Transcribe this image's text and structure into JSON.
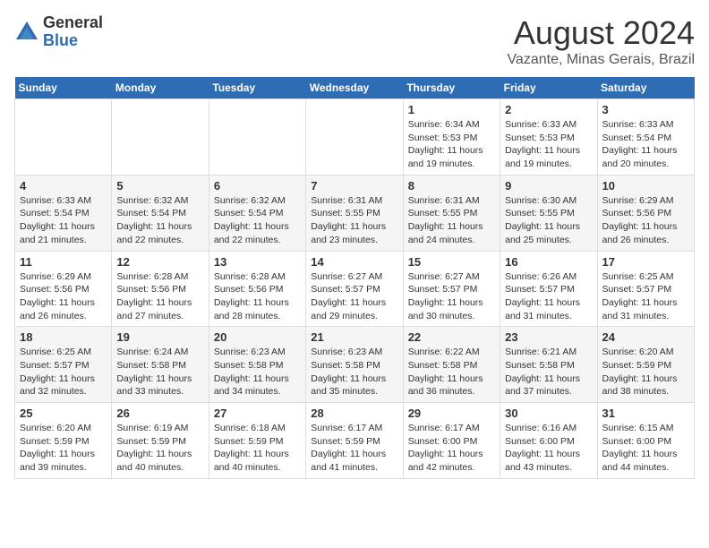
{
  "header": {
    "logo_general": "General",
    "logo_blue": "Blue",
    "month_title": "August 2024",
    "subtitle": "Vazante, Minas Gerais, Brazil"
  },
  "weekdays": [
    "Sunday",
    "Monday",
    "Tuesday",
    "Wednesday",
    "Thursday",
    "Friday",
    "Saturday"
  ],
  "weeks": [
    [
      {
        "day": "",
        "info": ""
      },
      {
        "day": "",
        "info": ""
      },
      {
        "day": "",
        "info": ""
      },
      {
        "day": "",
        "info": ""
      },
      {
        "day": "1",
        "info": "Sunrise: 6:34 AM\nSunset: 5:53 PM\nDaylight: 11 hours and 19 minutes."
      },
      {
        "day": "2",
        "info": "Sunrise: 6:33 AM\nSunset: 5:53 PM\nDaylight: 11 hours and 19 minutes."
      },
      {
        "day": "3",
        "info": "Sunrise: 6:33 AM\nSunset: 5:54 PM\nDaylight: 11 hours and 20 minutes."
      }
    ],
    [
      {
        "day": "4",
        "info": "Sunrise: 6:33 AM\nSunset: 5:54 PM\nDaylight: 11 hours and 21 minutes."
      },
      {
        "day": "5",
        "info": "Sunrise: 6:32 AM\nSunset: 5:54 PM\nDaylight: 11 hours and 22 minutes."
      },
      {
        "day": "6",
        "info": "Sunrise: 6:32 AM\nSunset: 5:54 PM\nDaylight: 11 hours and 22 minutes."
      },
      {
        "day": "7",
        "info": "Sunrise: 6:31 AM\nSunset: 5:55 PM\nDaylight: 11 hours and 23 minutes."
      },
      {
        "day": "8",
        "info": "Sunrise: 6:31 AM\nSunset: 5:55 PM\nDaylight: 11 hours and 24 minutes."
      },
      {
        "day": "9",
        "info": "Sunrise: 6:30 AM\nSunset: 5:55 PM\nDaylight: 11 hours and 25 minutes."
      },
      {
        "day": "10",
        "info": "Sunrise: 6:29 AM\nSunset: 5:56 PM\nDaylight: 11 hours and 26 minutes."
      }
    ],
    [
      {
        "day": "11",
        "info": "Sunrise: 6:29 AM\nSunset: 5:56 PM\nDaylight: 11 hours and 26 minutes."
      },
      {
        "day": "12",
        "info": "Sunrise: 6:28 AM\nSunset: 5:56 PM\nDaylight: 11 hours and 27 minutes."
      },
      {
        "day": "13",
        "info": "Sunrise: 6:28 AM\nSunset: 5:56 PM\nDaylight: 11 hours and 28 minutes."
      },
      {
        "day": "14",
        "info": "Sunrise: 6:27 AM\nSunset: 5:57 PM\nDaylight: 11 hours and 29 minutes."
      },
      {
        "day": "15",
        "info": "Sunrise: 6:27 AM\nSunset: 5:57 PM\nDaylight: 11 hours and 30 minutes."
      },
      {
        "day": "16",
        "info": "Sunrise: 6:26 AM\nSunset: 5:57 PM\nDaylight: 11 hours and 31 minutes."
      },
      {
        "day": "17",
        "info": "Sunrise: 6:25 AM\nSunset: 5:57 PM\nDaylight: 11 hours and 31 minutes."
      }
    ],
    [
      {
        "day": "18",
        "info": "Sunrise: 6:25 AM\nSunset: 5:57 PM\nDaylight: 11 hours and 32 minutes."
      },
      {
        "day": "19",
        "info": "Sunrise: 6:24 AM\nSunset: 5:58 PM\nDaylight: 11 hours and 33 minutes."
      },
      {
        "day": "20",
        "info": "Sunrise: 6:23 AM\nSunset: 5:58 PM\nDaylight: 11 hours and 34 minutes."
      },
      {
        "day": "21",
        "info": "Sunrise: 6:23 AM\nSunset: 5:58 PM\nDaylight: 11 hours and 35 minutes."
      },
      {
        "day": "22",
        "info": "Sunrise: 6:22 AM\nSunset: 5:58 PM\nDaylight: 11 hours and 36 minutes."
      },
      {
        "day": "23",
        "info": "Sunrise: 6:21 AM\nSunset: 5:58 PM\nDaylight: 11 hours and 37 minutes."
      },
      {
        "day": "24",
        "info": "Sunrise: 6:20 AM\nSunset: 5:59 PM\nDaylight: 11 hours and 38 minutes."
      }
    ],
    [
      {
        "day": "25",
        "info": "Sunrise: 6:20 AM\nSunset: 5:59 PM\nDaylight: 11 hours and 39 minutes."
      },
      {
        "day": "26",
        "info": "Sunrise: 6:19 AM\nSunset: 5:59 PM\nDaylight: 11 hours and 40 minutes."
      },
      {
        "day": "27",
        "info": "Sunrise: 6:18 AM\nSunset: 5:59 PM\nDaylight: 11 hours and 40 minutes."
      },
      {
        "day": "28",
        "info": "Sunrise: 6:17 AM\nSunset: 5:59 PM\nDaylight: 11 hours and 41 minutes."
      },
      {
        "day": "29",
        "info": "Sunrise: 6:17 AM\nSunset: 6:00 PM\nDaylight: 11 hours and 42 minutes."
      },
      {
        "day": "30",
        "info": "Sunrise: 6:16 AM\nSunset: 6:00 PM\nDaylight: 11 hours and 43 minutes."
      },
      {
        "day": "31",
        "info": "Sunrise: 6:15 AM\nSunset: 6:00 PM\nDaylight: 11 hours and 44 minutes."
      }
    ]
  ]
}
